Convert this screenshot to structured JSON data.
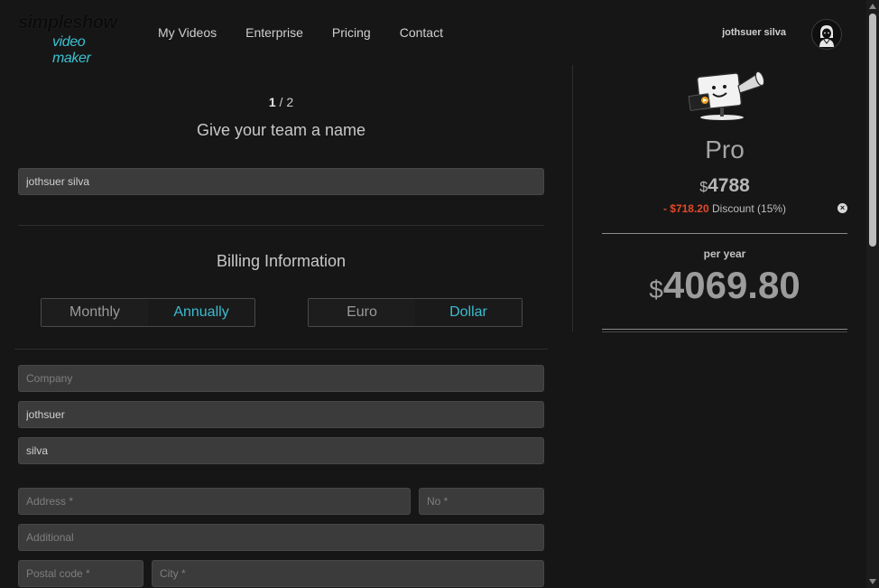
{
  "header": {
    "logo_top": "simpleshow",
    "logo_bottom": "video maker",
    "nav": [
      "My Videos",
      "Enterprise",
      "Pricing",
      "Contact"
    ],
    "user_name": "jothsuer silva"
  },
  "form": {
    "step_current": "1",
    "step_total": " / 2",
    "team_heading": "Give your team a name",
    "team_name_value": "jothsuer silva",
    "billing_heading": "Billing Information",
    "period_options": [
      "Monthly",
      "Annually"
    ],
    "period_selected": "Annually",
    "currency_options": [
      "Euro",
      "Dollar"
    ],
    "currency_selected": "Dollar",
    "company_placeholder": "Company",
    "first_name_value": "jothsuer",
    "last_name_value": "silva",
    "address_placeholder": "Address *",
    "number_placeholder": "No *",
    "additional_placeholder": "Additional",
    "postal_placeholder": "Postal code *",
    "city_placeholder": "City *"
  },
  "summary": {
    "plan": "Pro",
    "currency_symbol": "$",
    "list_price": "4788",
    "discount_prefix": "- ",
    "discount_amount": "$718.20",
    "discount_label": " Discount (15%)",
    "remove_icon": "×",
    "per_label": "per year",
    "total": "4069.80"
  },
  "colors": {
    "accent": "#3bbcd0",
    "discount": "#e04a2a",
    "background": "#161616",
    "field": "#3b3b3b"
  }
}
